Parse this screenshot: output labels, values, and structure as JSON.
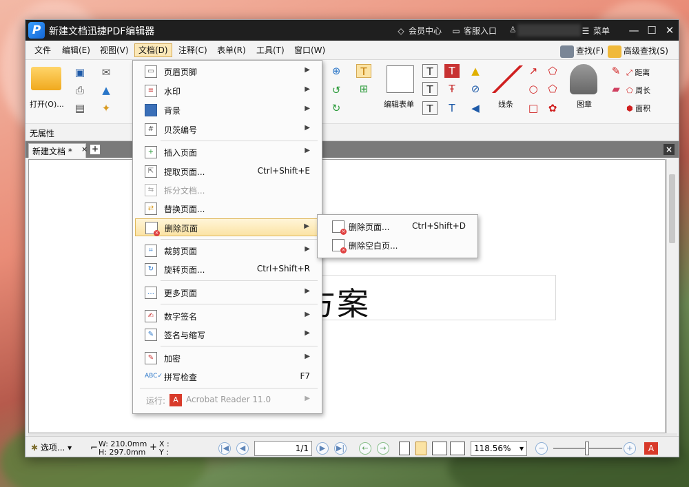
{
  "window": {
    "app_title": "新建文档迅捷PDF编辑器",
    "member_center": "会员中心",
    "customer_service": "客服入口",
    "menu_label": "菜单"
  },
  "menubar": {
    "items": [
      "文件",
      "编辑(E)",
      "视图(V)",
      "文档(D)",
      "注释(C)",
      "表单(R)",
      "工具(T)",
      "窗口(W)"
    ],
    "find": "查找(F)",
    "advanced_find": "高级查找(S)"
  },
  "ribbon": {
    "open_label": "打开(O)...",
    "edit_form_label": "编辑表单",
    "line_label": "线条",
    "stamp_label": "图章",
    "distance_label": "距离",
    "perimeter_label": "周长",
    "area_label": "面积"
  },
  "propbar": {
    "text": "无属性"
  },
  "tabs": {
    "doc_tab": "新建文档 *",
    "close": "×",
    "add": "+",
    "close_all": "×"
  },
  "document": {
    "heading": "方案"
  },
  "dropdown": {
    "items": [
      {
        "label": "页眉页脚",
        "arrow": "▶"
      },
      {
        "label": "水印",
        "arrow": "▶"
      },
      {
        "label": "背景",
        "arrow": "▶"
      },
      {
        "label": "贝茨编号",
        "arrow": "▶"
      },
      {
        "label": "插入页面",
        "arrow": "▶"
      },
      {
        "label": "提取页面...",
        "shortcut": "Ctrl+Shift+E"
      },
      {
        "label": "拆分文档..."
      },
      {
        "label": "替换页面..."
      },
      {
        "label": "删除页面",
        "arrow": "▶"
      },
      {
        "label": "裁剪页面",
        "arrow": "▶"
      },
      {
        "label": "旋转页面...",
        "shortcut": "Ctrl+Shift+R"
      },
      {
        "label": "更多页面",
        "arrow": "▶"
      },
      {
        "label": "数字签名",
        "arrow": "▶"
      },
      {
        "label": "签名与缩写",
        "arrow": "▶"
      },
      {
        "label": "加密",
        "arrow": "▶"
      },
      {
        "label": "拼写检查",
        "shortcut": "F7"
      },
      {
        "label": "运行:",
        "app": "Acrobat Reader 11.0",
        "arrow": "▶"
      }
    ]
  },
  "submenu": {
    "items": [
      {
        "label": "删除页面...",
        "shortcut": "Ctrl+Shift+D"
      },
      {
        "label": "删除空白页..."
      }
    ]
  },
  "statusbar": {
    "options": "选项...",
    "width": "W: 210.0mm",
    "height": "H: 297.0mm",
    "x": "X :",
    "y": "Y :",
    "page": "1/1",
    "zoom": "118.56%"
  },
  "colors": {
    "titlebar": "#1f1f1f",
    "highlight": "#fbe3a4",
    "accent_blue": "#1466d4",
    "delete_red": "#e04040"
  }
}
